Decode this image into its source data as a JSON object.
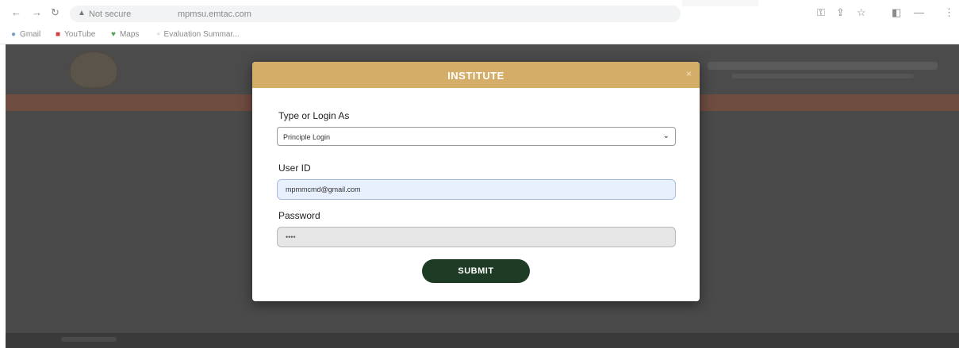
{
  "browser": {
    "not_secure": "Not secure",
    "url": "mpmsu.emtac.com",
    "bookmarks": [
      {
        "label": "Gmail"
      },
      {
        "label": "YouTube"
      },
      {
        "label": "Maps"
      },
      {
        "label": "Evaluation Summar..."
      }
    ]
  },
  "modal": {
    "title": "INSTITUTE",
    "close_icon": "×",
    "login_type": {
      "label": "Type or Login As",
      "selected": "Principle Login"
    },
    "user_id": {
      "label": "User ID",
      "value": "mpmmcmd@gmail.com"
    },
    "password": {
      "label": "Password",
      "value": "••••"
    },
    "submit_label": "SUBMIT"
  },
  "colors": {
    "modal_header": "#d4ad68",
    "submit_bg": "#1e3b26",
    "autofill_bg": "#e8f0fe",
    "page_band": "#6e4c40"
  }
}
